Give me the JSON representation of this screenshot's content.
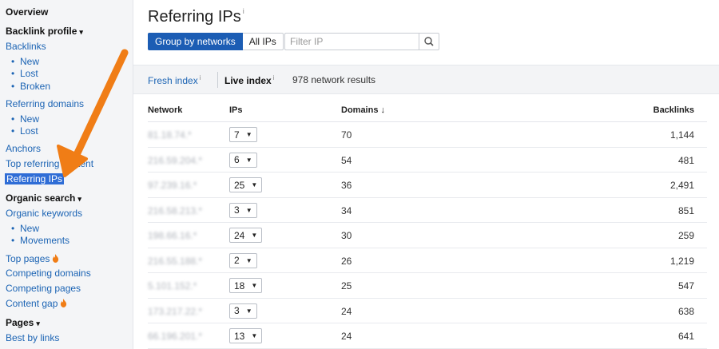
{
  "sidebar": {
    "overview": "Overview",
    "backlink_profile": "Backlink profile",
    "backlinks": "Backlinks",
    "backlinks_sub": [
      "New",
      "Lost",
      "Broken"
    ],
    "referring_domains": "Referring domains",
    "referring_domains_sub": [
      "New",
      "Lost"
    ],
    "anchors": "Anchors",
    "top_referring_content": "Top referring content",
    "referring_ips": "Referring IPs",
    "organic_search": "Organic search",
    "organic_keywords": "Organic keywords",
    "organic_keywords_sub": [
      "New",
      "Movements"
    ],
    "top_pages": "Top pages",
    "competing_domains": "Competing domains",
    "competing_pages": "Competing pages",
    "content_gap": "Content gap",
    "pages": "Pages",
    "best_by_links": "Best by links",
    "caret": "▾",
    "bullet": "•"
  },
  "header": {
    "title": "Referring IPs",
    "info": "i"
  },
  "toolbar": {
    "group_by_networks": "Group by networks",
    "all_ips": "All IPs",
    "filter_placeholder": "Filter IP"
  },
  "indexbar": {
    "fresh_index": "Fresh index",
    "live_index": "Live index",
    "info": "i",
    "count": "978 network results"
  },
  "table": {
    "headers": {
      "network": "Network",
      "ips": "IPs",
      "domains": "Domains ↓",
      "backlinks": "Backlinks"
    },
    "rows": [
      {
        "network": "81.18.74.*",
        "ips": "7",
        "domains": "70",
        "backlinks": "1,144"
      },
      {
        "network": "216.59.204.*",
        "ips": "6",
        "domains": "54",
        "backlinks": "481"
      },
      {
        "network": "97.239.16.*",
        "ips": "25",
        "domains": "36",
        "backlinks": "2,491"
      },
      {
        "network": "216.58.213.*",
        "ips": "3",
        "domains": "34",
        "backlinks": "851"
      },
      {
        "network": "198.66.16.*",
        "ips": "24",
        "domains": "30",
        "backlinks": "259"
      },
      {
        "network": "216.55.188.*",
        "ips": "2",
        "domains": "26",
        "backlinks": "1,219"
      },
      {
        "network": "5.101.152.*",
        "ips": "18",
        "domains": "25",
        "backlinks": "547"
      },
      {
        "network": "173.217.22.*",
        "ips": "3",
        "domains": "24",
        "backlinks": "638"
      },
      {
        "network": "66.196.201.*",
        "ips": "13",
        "domains": "24",
        "backlinks": "641"
      }
    ],
    "select_arrow": "▼"
  },
  "colors": {
    "accent": "#1c5db4",
    "link": "#1c64b4",
    "arrow": "#f07d16",
    "fire": "#f07d16",
    "sidebar_bg": "#f4f5f7"
  }
}
